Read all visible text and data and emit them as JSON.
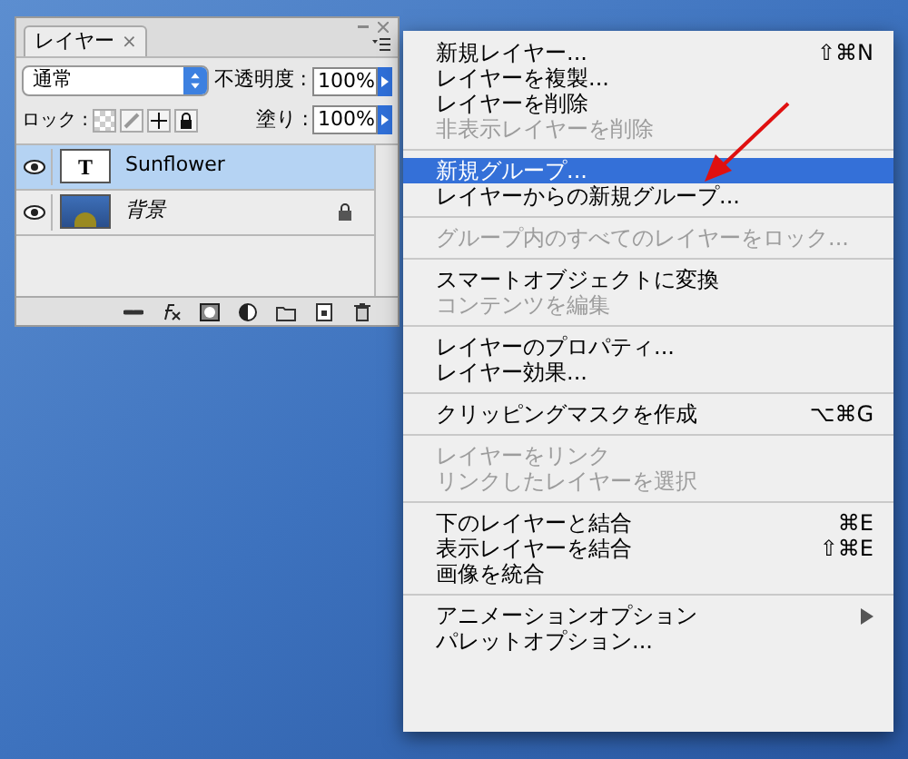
{
  "panel": {
    "tab": {
      "label": "レイヤー",
      "close": "×"
    },
    "blend_mode": "通常",
    "opacity": {
      "label": "不透明度 :",
      "value": "100%"
    },
    "lock": {
      "label": "ロック :"
    },
    "fill": {
      "label": "塗り :",
      "value": "100%"
    },
    "layers": [
      {
        "name": "Sunflower",
        "kind": "text",
        "thumb": "T",
        "selected": true,
        "visible": true,
        "locked": false
      },
      {
        "name": "背景",
        "kind": "image",
        "selected": false,
        "visible": true,
        "locked": true
      }
    ]
  },
  "menu": {
    "groups": [
      [
        {
          "label": "新規レイヤー...",
          "shortcut": "⇧⌘N",
          "kind": "command",
          "disabled": false,
          "selected": false
        },
        {
          "label": "レイヤーを複製...",
          "kind": "command",
          "disabled": false,
          "selected": false
        },
        {
          "label": "レイヤーを削除",
          "kind": "command",
          "disabled": false,
          "selected": false
        },
        {
          "label": "非表示レイヤーを削除",
          "kind": "command",
          "disabled": true,
          "selected": false
        }
      ],
      [
        {
          "label": "新規グループ...",
          "kind": "command",
          "disabled": false,
          "selected": true
        },
        {
          "label": "レイヤーからの新規グループ...",
          "kind": "command",
          "disabled": false,
          "selected": false
        }
      ],
      [
        {
          "label": "グループ内のすべてのレイヤーをロック...",
          "kind": "command",
          "disabled": true,
          "selected": false
        }
      ],
      [
        {
          "label": "スマートオブジェクトに変換",
          "kind": "command",
          "disabled": false,
          "selected": false
        },
        {
          "label": "コンテンツを編集",
          "kind": "command",
          "disabled": true,
          "selected": false
        }
      ],
      [
        {
          "label": "レイヤーのプロパティ...",
          "kind": "command",
          "disabled": false,
          "selected": false
        },
        {
          "label": "レイヤー効果...",
          "kind": "command",
          "disabled": false,
          "selected": false
        }
      ],
      [
        {
          "label": "クリッピングマスクを作成",
          "shortcut": "⌥⌘G",
          "kind": "command",
          "disabled": false,
          "selected": false
        }
      ],
      [
        {
          "label": "レイヤーをリンク",
          "kind": "command",
          "disabled": true,
          "selected": false
        },
        {
          "label": "リンクしたレイヤーを選択",
          "kind": "command",
          "disabled": true,
          "selected": false
        }
      ],
      [
        {
          "label": "下のレイヤーと結合",
          "shortcut": "⌘E",
          "kind": "command",
          "disabled": false,
          "selected": false
        },
        {
          "label": "表示レイヤーを結合",
          "shortcut": "⇧⌘E",
          "kind": "command",
          "disabled": false,
          "selected": false
        },
        {
          "label": "画像を統合",
          "kind": "command",
          "disabled": false,
          "selected": false
        }
      ],
      [
        {
          "label": "アニメーションオプション",
          "kind": "submenu",
          "disabled": false,
          "selected": false
        },
        {
          "label": "パレットオプション...",
          "kind": "command",
          "disabled": false,
          "selected": false
        }
      ]
    ]
  }
}
